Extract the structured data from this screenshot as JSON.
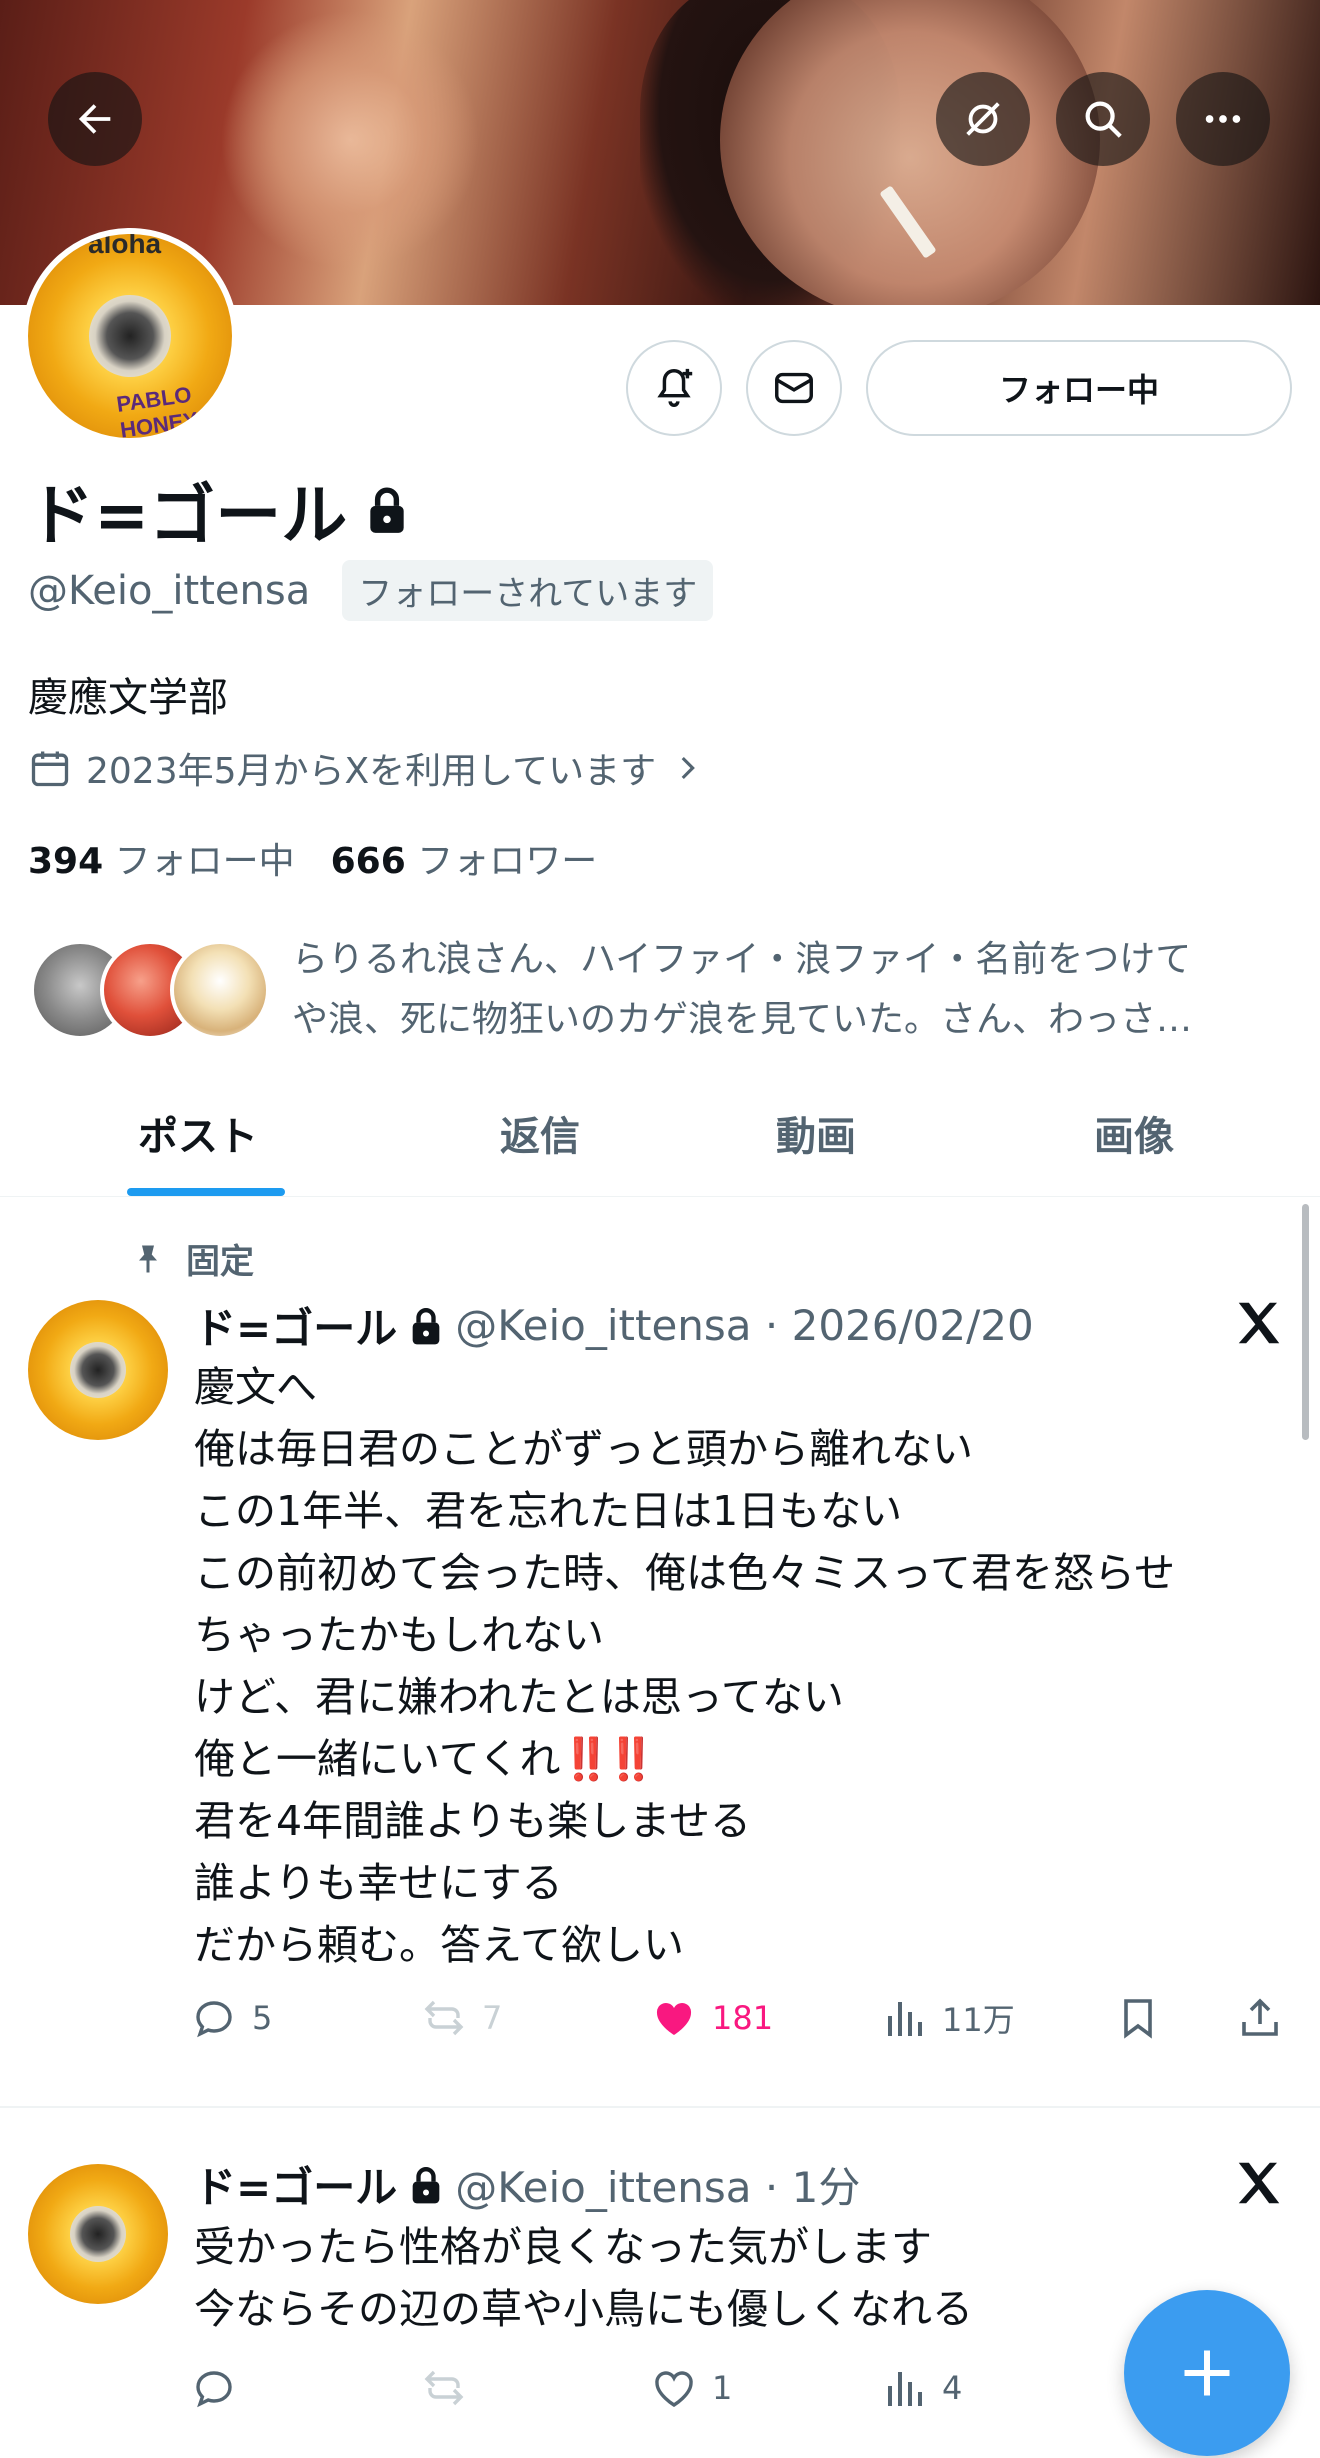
{
  "header": {
    "back_icon": "arrow-left-icon",
    "grok_icon": "grok-icon",
    "search_icon": "search-icon",
    "more_icon": "more-icon"
  },
  "profile": {
    "name": "ド=ゴール",
    "handle": "@Keio_ittensa",
    "follows_you": "フォローされています",
    "bio": "慶應文学部",
    "joined": "2023年5月からXを利用しています",
    "following_count": "394",
    "following_label": "フォロー中",
    "followers_count": "666",
    "followers_label": "フォロワー",
    "followed_by_line1": "らりるれ浪さん、ハイファイ・浪ファイ・名前をつけて",
    "followed_by_line2": "や浪、死に物狂いのカゲ浪を見ていた。さん、わっさ…",
    "follow_button": "フォロー中",
    "avatar_text_top": "aloha",
    "avatar_text": "PABLO HONEY"
  },
  "tabs": [
    "ポスト",
    "返信",
    "動画",
    "画像"
  ],
  "pinned_label": "固定",
  "posts": [
    {
      "name": "ド=ゴール",
      "meta": "@Keio_ittensa · 2026/02/20",
      "lines": [
        "慶文へ",
        "俺は毎日君のことがずっと頭から離れない",
        "この1年半、君を忘れた日は1日もない",
        "この前初めて会った時、俺は色々ミスって君を怒らせ",
        "ちゃったかもしれない",
        "けど、君に嫌われたとは思ってない",
        "俺と一緒にいてくれ",
        "君を4年間誰よりも楽しませる",
        "誰よりも幸せにする",
        "だから頼む。答えて欲しい"
      ],
      "emphasis": "‼️‼️",
      "replies": "5",
      "reposts": "7",
      "likes": "181",
      "views": "11万"
    },
    {
      "name": "ド=ゴール",
      "meta": "@Keio_ittensa · 1分",
      "lines": [
        "受かったら性格が良くなった気がします",
        "今ならその辺の草や小鳥にも優しくなれる"
      ],
      "replies": "",
      "reposts": "",
      "likes": "1",
      "views": "4"
    }
  ],
  "colors": {
    "accent": "#1d9bf0",
    "like": "#f91880",
    "secondary_text": "#536471",
    "fab": "#3b9cf0"
  }
}
